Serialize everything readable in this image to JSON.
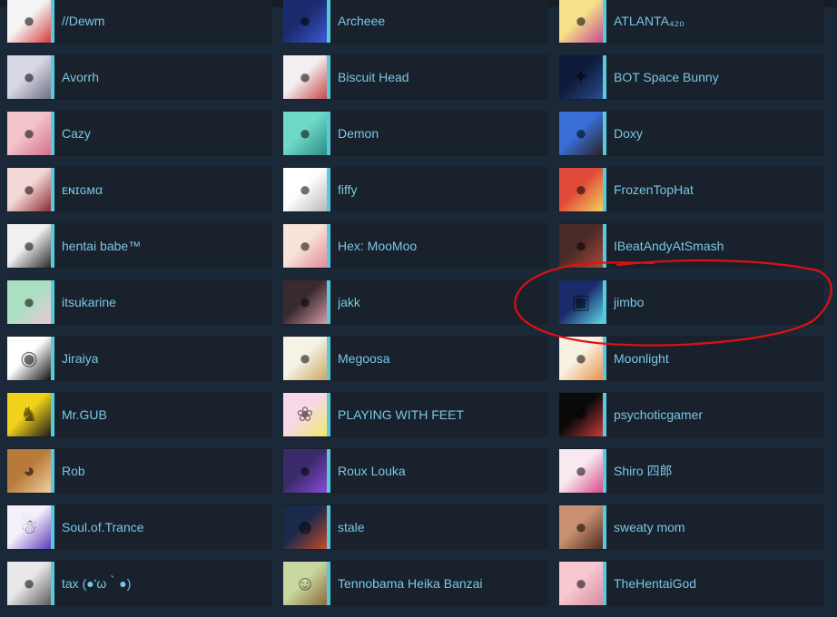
{
  "friends": [
    {
      "name": "//Dewm",
      "avatar": [
        "#f4f4f4",
        "#d63a3a"
      ],
      "icon": "anime-avatar-icon"
    },
    {
      "name": "Archeee",
      "avatar": [
        "#1a2c6e",
        "#3b5ad6"
      ],
      "icon": "anime-avatar-icon"
    },
    {
      "name": "ATLANTA₄₂₀",
      "avatar": [
        "#f6e08a",
        "#c74a8f"
      ],
      "icon": "anime-avatar-icon"
    },
    {
      "name": "Avorrh",
      "avatar": [
        "#d8d8e6",
        "#6f6f86"
      ],
      "icon": "anime-avatar-icon"
    },
    {
      "name": "Biscuit Head",
      "avatar": [
        "#f3eef0",
        "#c64848"
      ],
      "icon": "anime-avatar-icon"
    },
    {
      "name": "BOT Space Bunny",
      "avatar": [
        "#0e1b3a",
        "#2b4c8e"
      ],
      "icon": "text-avatar-icon"
    },
    {
      "name": "Cazy",
      "avatar": [
        "#f2c4cc",
        "#d3708a"
      ],
      "icon": "anime-avatar-icon"
    },
    {
      "name": "Demon",
      "avatar": [
        "#6fd8c8",
        "#2a8c86"
      ],
      "icon": "anime-avatar-icon"
    },
    {
      "name": "Doxy",
      "avatar": [
        "#3a6fd8",
        "#2a2020"
      ],
      "icon": "person-avatar-icon"
    },
    {
      "name": "ᴇɴɪɢᴍα",
      "avatar": [
        "#f4d8d6",
        "#8a2a30"
      ],
      "icon": "anime-avatar-icon"
    },
    {
      "name": "fiffy",
      "avatar": [
        "#ffffff",
        "#b8b8b8"
      ],
      "icon": "sketch-avatar-icon"
    },
    {
      "name": "FrozenTopHat",
      "avatar": [
        "#e24a3a",
        "#f2d25a"
      ],
      "icon": "anime-avatar-icon"
    },
    {
      "name": "hentai babe™",
      "avatar": [
        "#f0f0f0",
        "#2a2a2a"
      ],
      "icon": "manga-avatar-icon"
    },
    {
      "name": "Hex: MooMoo",
      "avatar": [
        "#f8e4d8",
        "#e48a9a"
      ],
      "icon": "anime-avatar-icon"
    },
    {
      "name": "IBeatAndyAtSmash",
      "avatar": [
        "#4a2a26",
        "#a84a3a"
      ],
      "icon": "person-avatar-icon"
    },
    {
      "name": "itsukarine",
      "avatar": [
        "#a8e0c0",
        "#e8c8d8"
      ],
      "icon": "anime-avatar-icon"
    },
    {
      "name": "jakk",
      "avatar": [
        "#3a2a30",
        "#d89aa8"
      ],
      "icon": "person-avatar-icon"
    },
    {
      "name": "jimbo",
      "avatar": [
        "#1a2a6a",
        "#5ad8e8"
      ],
      "icon": "game-avatar-icon"
    },
    {
      "name": "Jiraiya",
      "avatar": [
        "#ffffff",
        "#111111"
      ],
      "icon": "ninja-avatar-icon"
    },
    {
      "name": "Megoosa",
      "avatar": [
        "#f6f2e6",
        "#c8a860"
      ],
      "icon": "anime-avatar-icon"
    },
    {
      "name": "Moonlight",
      "avatar": [
        "#f8f0e0",
        "#e8904a"
      ],
      "icon": "anime-avatar-icon"
    },
    {
      "name": "Mr.GUB",
      "avatar": [
        "#f2d21a",
        "#1a1a1a"
      ],
      "icon": "heraldic-lion-icon"
    },
    {
      "name": "PLAYING WITH FEET",
      "avatar": [
        "#f8d8e8",
        "#f0e86a"
      ],
      "icon": "pony-avatar-icon"
    },
    {
      "name": "psychoticgamer",
      "avatar": [
        "#0a0a0a",
        "#c83a3a"
      ],
      "icon": "dark-avatar-icon"
    },
    {
      "name": "Rob",
      "avatar": [
        "#b87a3a",
        "#f0d0a0"
      ],
      "icon": "dog-avatar-icon"
    },
    {
      "name": "Roux Louka",
      "avatar": [
        "#3a2a6a",
        "#8a4ad8"
      ],
      "icon": "anime-avatar-icon"
    },
    {
      "name": "Shiro 四郎",
      "avatar": [
        "#f8e8f0",
        "#d84a8a"
      ],
      "icon": "anime-avatar-icon"
    },
    {
      "name": "Soul.of.Trance",
      "avatar": [
        "#f4f0fa",
        "#5a3ab8"
      ],
      "icon": "ghost-avatar-icon"
    },
    {
      "name": "stale",
      "avatar": [
        "#1a2a4a",
        "#c84a2a"
      ],
      "icon": "robot-avatar-icon"
    },
    {
      "name": "sweaty mom",
      "avatar": [
        "#c89070",
        "#4a2a20"
      ],
      "icon": "person-avatar-icon"
    },
    {
      "name": "tax (●'ω｀●)",
      "avatar": [
        "#e8e8e8",
        "#5a5a5a"
      ],
      "icon": "manga-avatar-icon"
    },
    {
      "name": "Tennobama Heika Banzai",
      "avatar": [
        "#c8d8a0",
        "#8a6a3a"
      ],
      "icon": "yoda-avatar-icon"
    },
    {
      "name": "TheHentaiGod",
      "avatar": [
        "#f8c8d0",
        "#d88aa0"
      ],
      "icon": "person-avatar-icon"
    }
  ],
  "colors": {
    "background": "#1b2838",
    "card": "#18212c",
    "name_text": "#7bc6e4",
    "online_status": "#57cbde",
    "annotation": "#e01010"
  }
}
